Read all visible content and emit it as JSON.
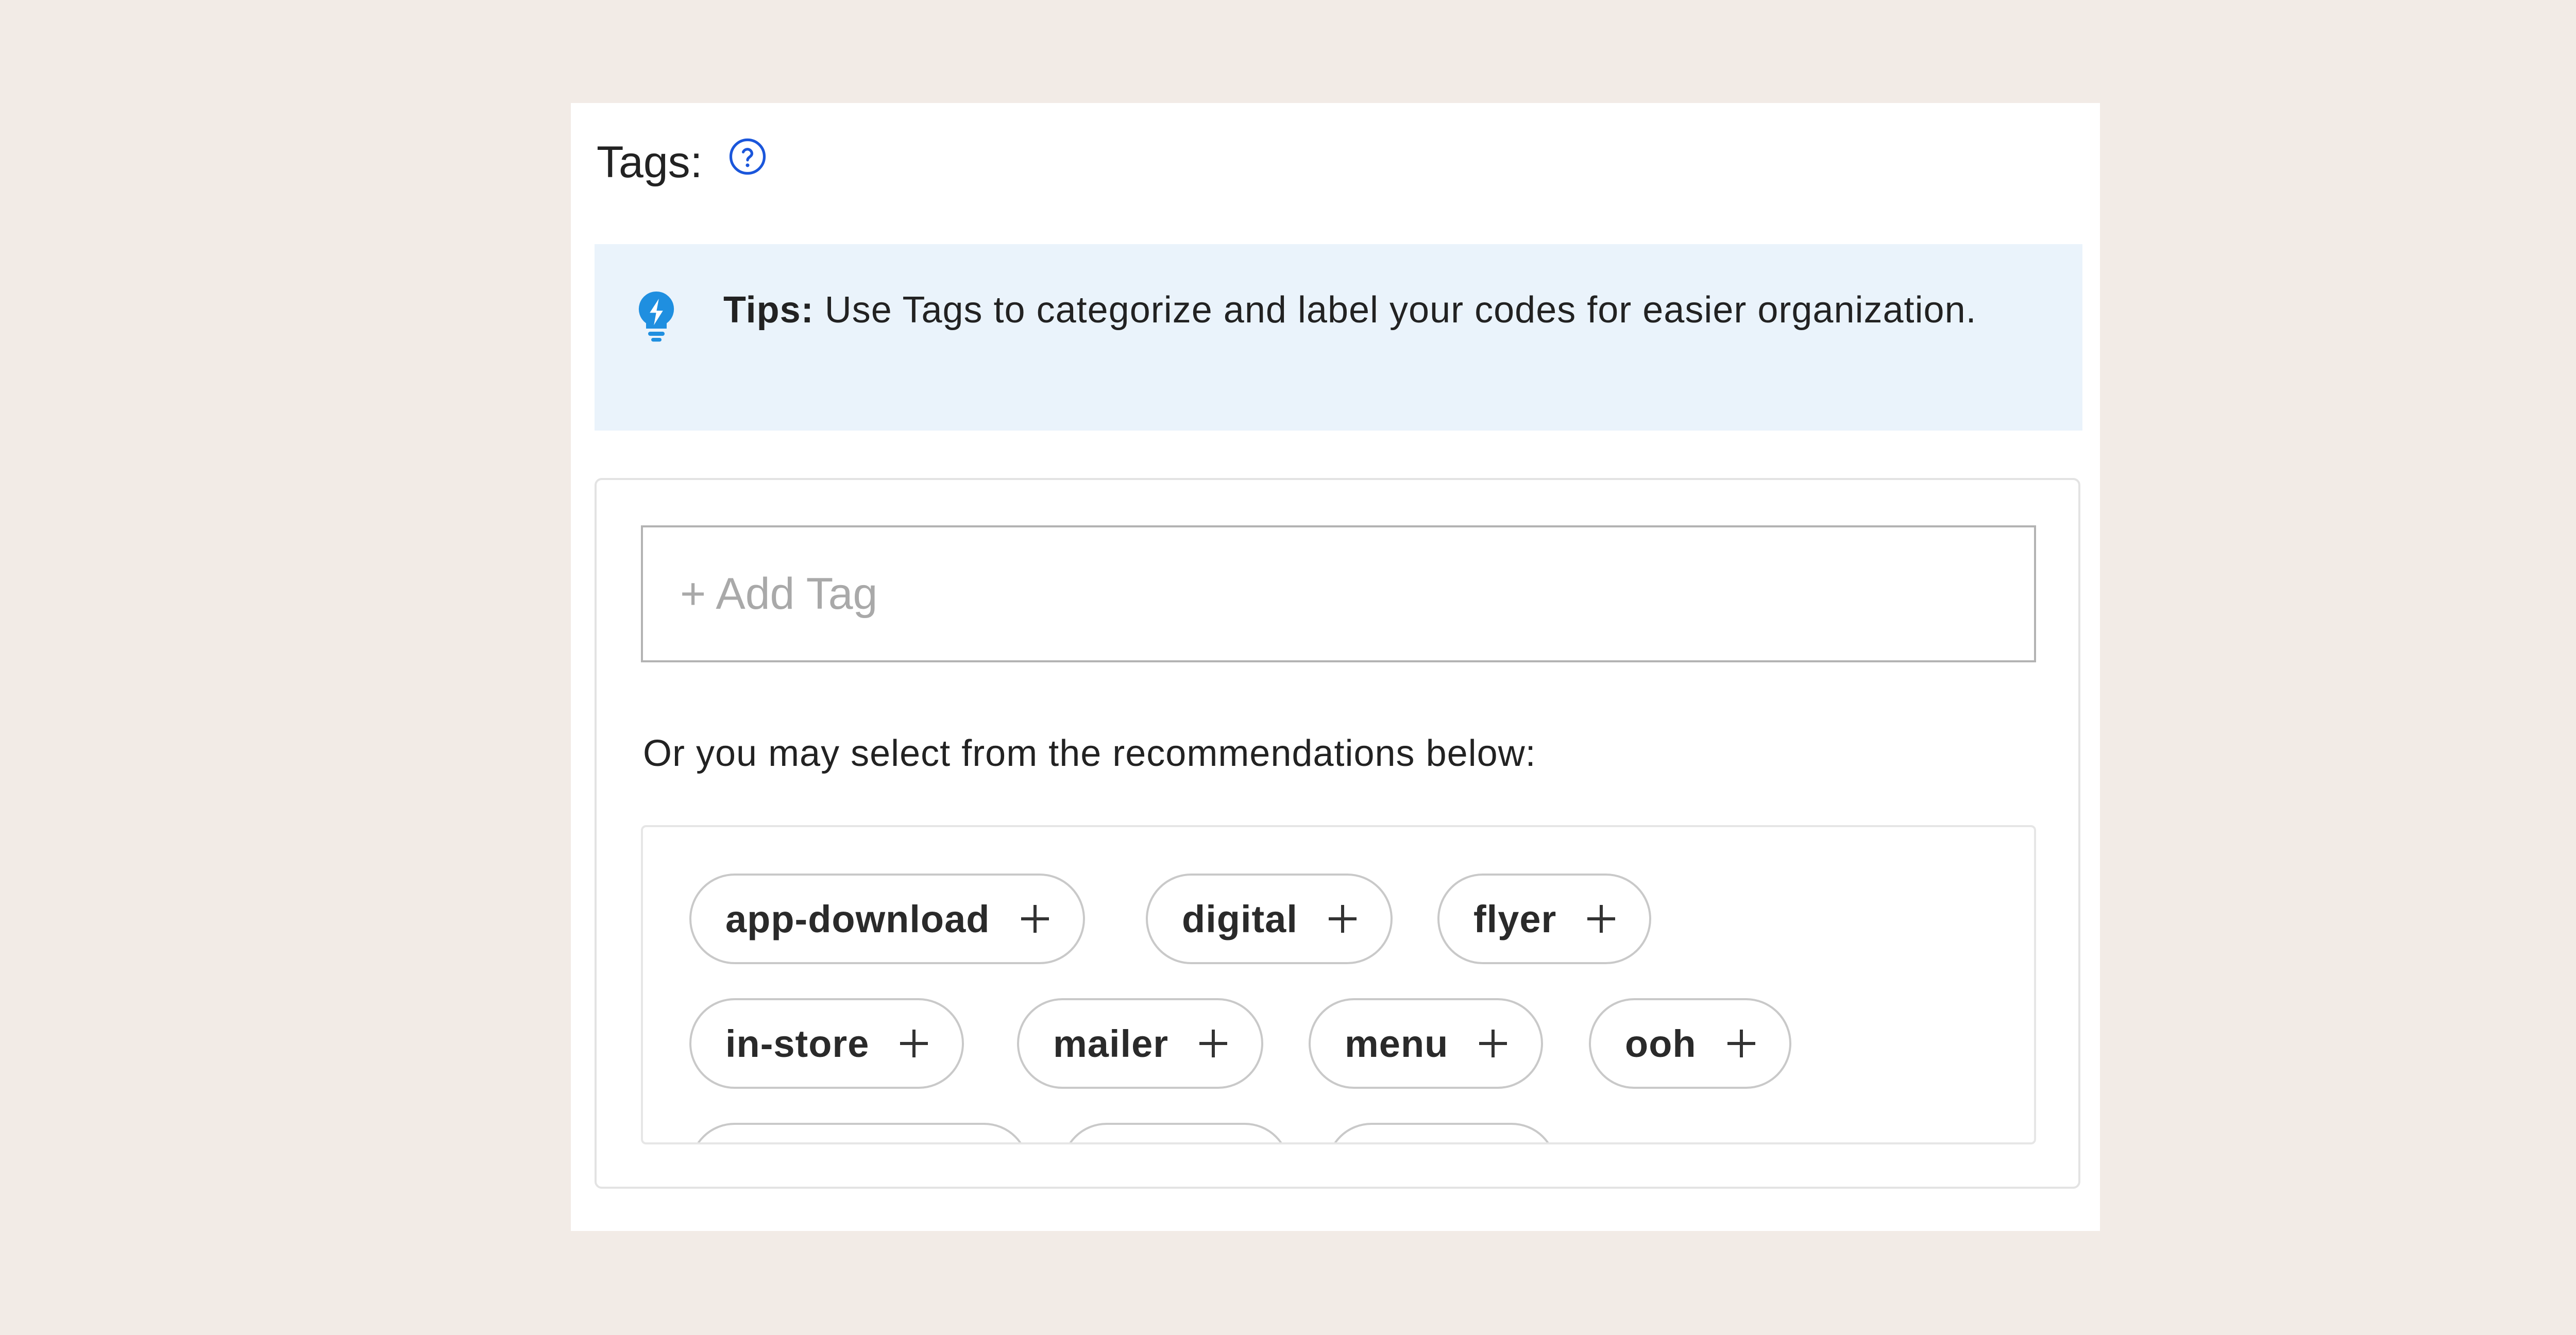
{
  "tags_section": {
    "title": "Tags:",
    "help_icon": "question-circle-icon",
    "accent_color": "#1a56db"
  },
  "tips": {
    "icon": "lightbulb-icon",
    "label": "Tips:",
    "text": "Use Tags to categorize and label your codes for easier organization.",
    "background": "#eaf3fb"
  },
  "add_tag": {
    "placeholder": "+ Add Tag",
    "value": ""
  },
  "recommendations": {
    "label": "Or you may select from the recommendations below:",
    "tags": [
      {
        "label": "app-download",
        "icon": "plus-icon"
      },
      {
        "label": "digital",
        "icon": "plus-icon"
      },
      {
        "label": "flyer",
        "icon": "plus-icon"
      },
      {
        "label": "in-store",
        "icon": "plus-icon"
      },
      {
        "label": "mailer",
        "icon": "plus-icon"
      },
      {
        "label": "menu",
        "icon": "plus-icon"
      },
      {
        "label": "ooh",
        "icon": "plus-icon"
      }
    ]
  }
}
